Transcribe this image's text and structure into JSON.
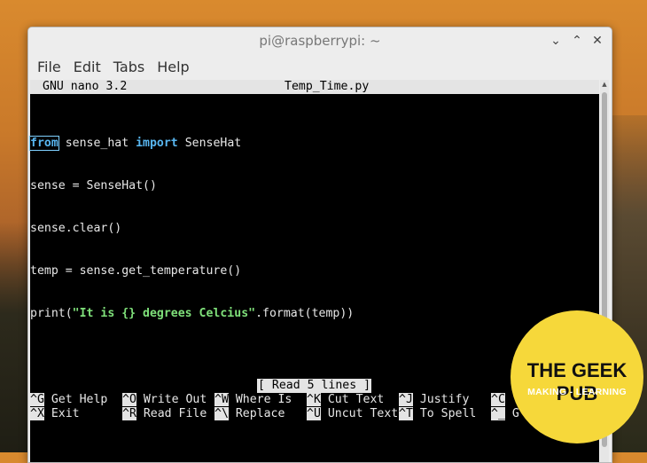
{
  "window": {
    "title": "pi@raspberrypi: ~",
    "controls": {
      "minimize": "⌄",
      "maximize": "⌃",
      "close": "✕"
    }
  },
  "menu": [
    "File",
    "Edit",
    "Tabs",
    "Help"
  ],
  "nano": {
    "version": "GNU nano 3.2",
    "filename": "Temp_Time.py",
    "code": {
      "l1_kw1": "from",
      "l1_mid": " sense_hat ",
      "l1_kw2": "import",
      "l1_end": " SenseHat",
      "l2": "sense = SenseHat()",
      "l3": "sense.clear()",
      "l4": "temp = sense.get_temperature()",
      "l5_start": "print(",
      "l5_str": "\"It is {} degrees Celcius\"",
      "l5_end": ".format(temp))"
    },
    "status": "[ Read 5 lines ]",
    "shortcuts_row1": [
      {
        "key": "^G",
        "label": " Get Help"
      },
      {
        "key": "^O",
        "label": " Write Out"
      },
      {
        "key": "^W",
        "label": " Where Is"
      },
      {
        "key": "^K",
        "label": " Cut Text"
      },
      {
        "key": "^J",
        "label": " Justify"
      },
      {
        "key": "^C",
        "label": ""
      }
    ],
    "shortcuts_row2": [
      {
        "key": "^X",
        "label": " Exit"
      },
      {
        "key": "^R",
        "label": " Read File"
      },
      {
        "key": "^\\",
        "label": " Replace"
      },
      {
        "key": "^U",
        "label": " Uncut Text"
      },
      {
        "key": "^T",
        "label": " To Spell"
      },
      {
        "key": "^_",
        "label": " G"
      }
    ]
  },
  "logo": {
    "name": "THE GEEK PUB",
    "tagline": "MAKING - LEARNING"
  }
}
